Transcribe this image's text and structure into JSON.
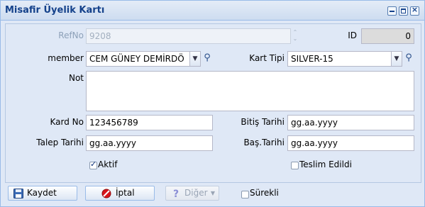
{
  "window": {
    "title": "Misafir Üyelik Kartı"
  },
  "form": {
    "refno": {
      "label": "RefNo",
      "value": "9208"
    },
    "id": {
      "label": "ID",
      "value": "0"
    },
    "member": {
      "label": "member",
      "value": "CEM GÜNEY DEMİRDÖ"
    },
    "kart_tipi": {
      "label": "Kart Tipi",
      "value": "SILVER-15"
    },
    "not": {
      "label": "Not",
      "value": ""
    },
    "kard_no": {
      "label": "Kard No",
      "value": "123456789"
    },
    "bitis_tarihi": {
      "label": "Bitiş Tarihi",
      "value": "gg.aa.yyyy"
    },
    "talep_tarihi": {
      "label": "Talep Tarihi",
      "value": "gg.aa.yyyy"
    },
    "bas_tarihi": {
      "label": "Baş.Tarihi",
      "value": "gg.aa.yyyy"
    },
    "aktif": {
      "label": "Aktif",
      "checked": true
    },
    "teslim_edildi": {
      "label": "Teslim Edildi",
      "checked": false
    }
  },
  "toolbar": {
    "save_label": "Kaydet",
    "cancel_label": "İptal",
    "other_label": "Diğer",
    "surekli": {
      "label": "Sürekli",
      "checked": false
    }
  },
  "icons": {
    "tools": [
      "minimize-icon",
      "maximize-icon",
      "close-icon"
    ],
    "save": "floppy-disk-icon",
    "cancel": "no-entry-icon",
    "other": "question-mark-icon",
    "search": "magnifier-icon"
  },
  "colors": {
    "title_text": "#15428b",
    "panel_bg": "#dfe8f6",
    "border": "#99bbe8"
  }
}
